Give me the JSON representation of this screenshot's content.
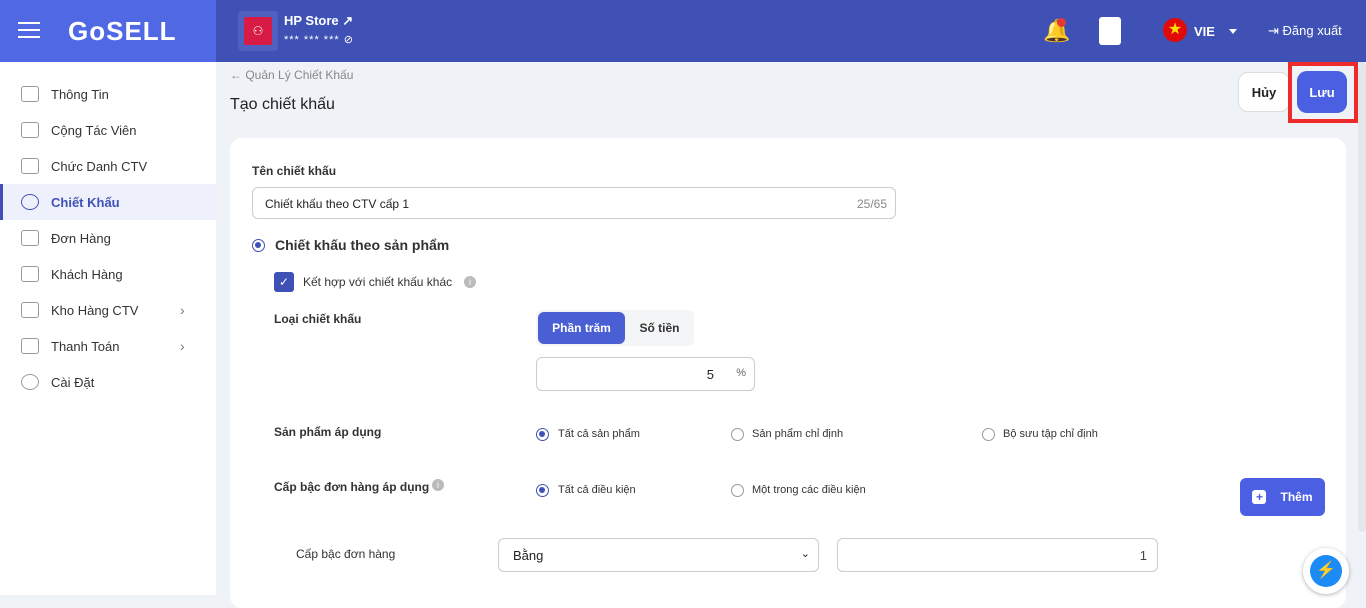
{
  "header": {
    "logo": "GoSELL",
    "store_name": "HP Store",
    "store_sub": "*** *** ***",
    "lang": "VIE",
    "logout": "Đăng xuất"
  },
  "sidebar": {
    "items": [
      {
        "label": "Thông Tin"
      },
      {
        "label": "Cộng Tác Viên"
      },
      {
        "label": "Chức Danh CTV"
      },
      {
        "label": "Chiết Khấu",
        "active": true
      },
      {
        "label": "Đơn Hàng"
      },
      {
        "label": "Khách Hàng"
      },
      {
        "label": "Kho Hàng CTV",
        "chevron": true
      },
      {
        "label": "Thanh Toán",
        "chevron": true
      },
      {
        "label": "Cài Đặt"
      }
    ]
  },
  "page": {
    "breadcrumb": "← Quản Lý Chiết Khấu",
    "title": "Tạo chiết khấu",
    "cancel": "Hủy",
    "save": "Lưu"
  },
  "form": {
    "name_label": "Tên chiết khấu",
    "name_value": "Chiết khấu theo CTV cấp 1",
    "name_count": "25/65",
    "type_radio": "Chiết khấu theo sản phẩm",
    "combine_label": "Kết hợp với chiết khấu khác",
    "combine_checked": true,
    "discount_type_label": "Loại chiết khấu",
    "discount_types": [
      "Phần trăm",
      "Số tiền"
    ],
    "discount_type_selected": "Phần trăm",
    "discount_value": "5",
    "discount_unit": "%",
    "product_label": "Sản phẩm áp dụng",
    "product_options": [
      "Tất cả sản phẩm",
      "Sản phẩm chỉ định",
      "Bộ sưu tập chỉ định"
    ],
    "product_selected": "Tất cả sản phẩm",
    "tier_label": "Cấp bậc đơn hàng áp dụng",
    "tier_options": [
      "Tất cả điều kiện",
      "Một trong các điều kiện"
    ],
    "tier_selected": "Tất cả điều kiện",
    "add_button": "Thêm",
    "condition_label": "Cấp bậc đơn hàng",
    "condition_operator": "Bằng",
    "condition_value": "1"
  },
  "colors": {
    "primary": "#3f51b5",
    "accent": "#4a5fe2",
    "highlight": "#ee2a2a"
  }
}
